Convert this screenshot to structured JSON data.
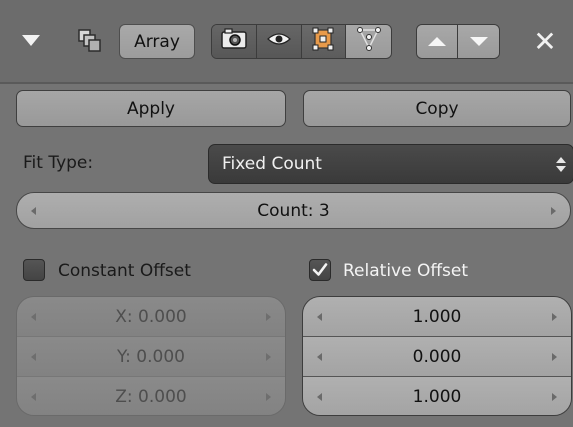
{
  "header": {
    "modifier_name": "Array",
    "icons": [
      "collapse-arrow-icon",
      "array-modifier-icon",
      "render-camera-icon",
      "eye-icon",
      "edit-mode-icon",
      "cage-icon",
      "move-up-icon",
      "move-down-icon",
      "close-icon"
    ]
  },
  "buttons": {
    "apply": "Apply",
    "copy": "Copy"
  },
  "fit": {
    "label": "Fit Type:",
    "value": "Fixed Count"
  },
  "count": {
    "label": "Count: 3"
  },
  "constant_offset": {
    "label": "Constant Offset",
    "checked": false,
    "x": "X: 0.000",
    "y": "Y: 0.000",
    "z": "Z: 0.000"
  },
  "relative_offset": {
    "label": "Relative Offset",
    "checked": true,
    "x": "1.000",
    "y": "0.000",
    "z": "1.000"
  }
}
